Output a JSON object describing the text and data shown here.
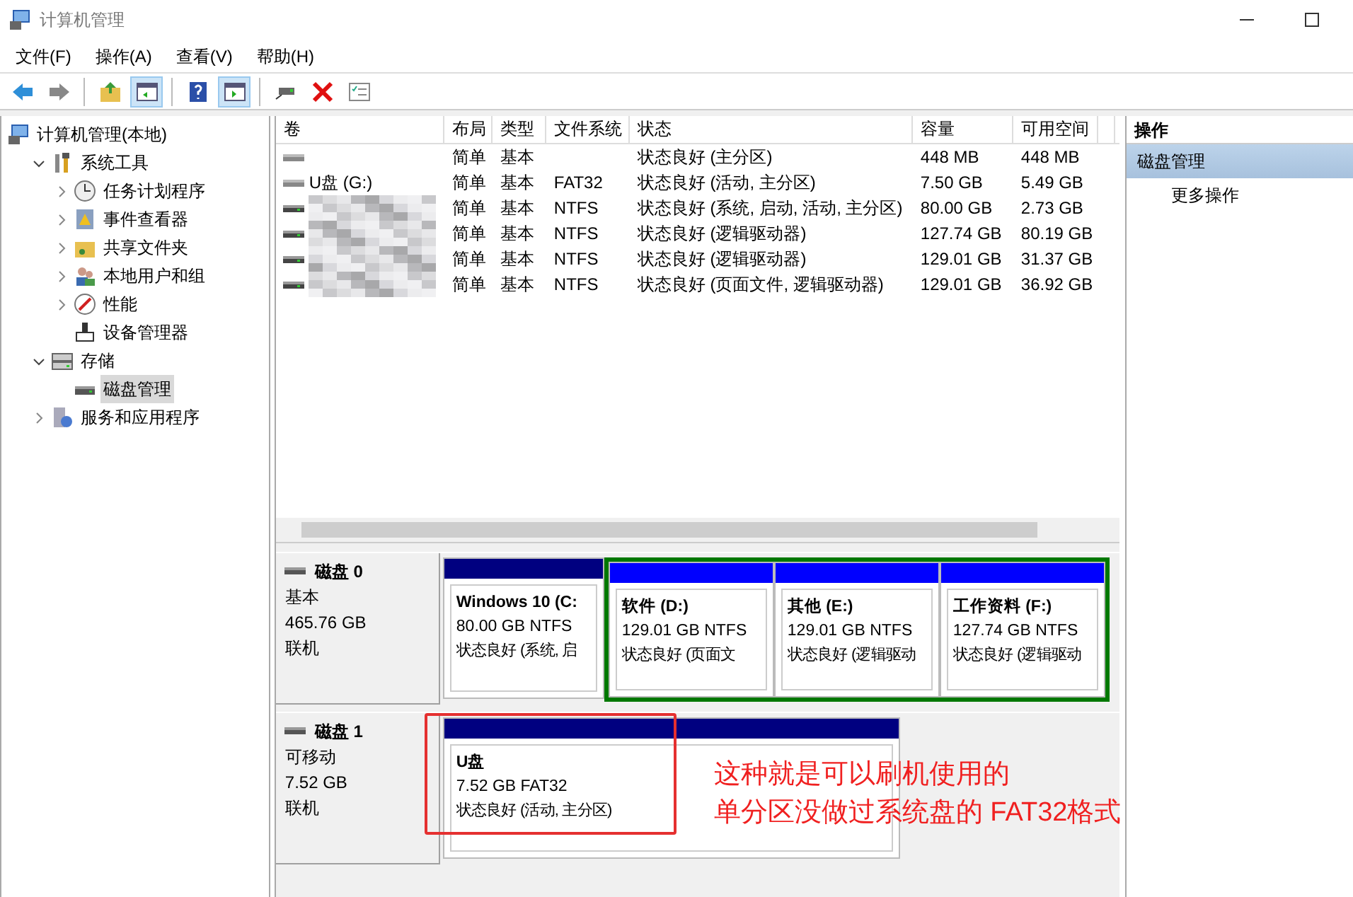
{
  "window": {
    "title": "计算机管理"
  },
  "menu": [
    "文件(F)",
    "操作(A)",
    "查看(V)",
    "帮助(H)"
  ],
  "toolbar": [
    {
      "kind": "back",
      "pressed": false
    },
    {
      "kind": "forward",
      "pressed": false
    },
    {
      "kind": "sep"
    },
    {
      "kind": "up",
      "pressed": false
    },
    {
      "kind": "tree",
      "pressed": true
    },
    {
      "kind": "sep"
    },
    {
      "kind": "help",
      "pressed": false
    },
    {
      "kind": "pane",
      "pressed": true
    },
    {
      "kind": "sep"
    },
    {
      "kind": "connect",
      "pressed": false
    },
    {
      "kind": "delete",
      "pressed": false
    },
    {
      "kind": "props",
      "pressed": false
    }
  ],
  "tree": {
    "label": "计算机管理(本地)",
    "selected": false,
    "children": [
      {
        "label": "系统工具",
        "expanded": true,
        "selected": false,
        "children": [
          {
            "label": "任务计划程序",
            "expanded": false,
            "selected": false
          },
          {
            "label": "事件查看器",
            "expanded": false,
            "selected": false
          },
          {
            "label": "共享文件夹",
            "expanded": false,
            "selected": false
          },
          {
            "label": "本地用户和组",
            "expanded": false,
            "selected": false
          },
          {
            "label": "性能",
            "expanded": false,
            "selected": false
          },
          {
            "label": "设备管理器",
            "selected": false
          }
        ]
      },
      {
        "label": "存储",
        "expanded": true,
        "selected": false,
        "children": [
          {
            "label": "磁盘管理",
            "selected": true
          }
        ]
      },
      {
        "label": "服务和应用程序",
        "expanded": false,
        "selected": false
      }
    ]
  },
  "volumes": {
    "columns": [
      "卷",
      "布局",
      "类型",
      "文件系统",
      "状态",
      "容量",
      "可用空间"
    ],
    "rows": [
      {
        "layout": "简单",
        "type": "基本",
        "status": "状态良好 (主分区)",
        "capacity": "448 MB",
        "free": "448 MB"
      },
      {
        "volume": "U盘 (G:)",
        "layout": "简单",
        "type": "基本",
        "fs": "FAT32",
        "status": "状态良好 (活动, 主分区)",
        "capacity": "7.50 GB",
        "free": "5.49 GB"
      },
      {
        "redacted": true,
        "layout": "简单",
        "type": "基本",
        "fs": "NTFS",
        "status": "状态良好 (系统, 启动, 活动, 主分区)",
        "capacity": "80.00 GB",
        "free": "2.73 GB"
      },
      {
        "redacted": true,
        "layout": "简单",
        "type": "基本",
        "fs": "NTFS",
        "status": "状态良好 (逻辑驱动器)",
        "capacity": "127.74 GB",
        "free": "80.19 GB"
      },
      {
        "redacted": true,
        "layout": "简单",
        "type": "基本",
        "fs": "NTFS",
        "status": "状态良好 (逻辑驱动器)",
        "capacity": "129.01 GB",
        "free": "31.37 GB"
      },
      {
        "redacted": true,
        "layout": "简单",
        "type": "基本",
        "fs": "NTFS",
        "status": "状态良好 (页面文件, 逻辑驱动器)",
        "capacity": "129.01 GB",
        "free": "36.92 GB"
      }
    ]
  },
  "actions": {
    "title": "操作",
    "items": [
      {
        "kind": "section",
        "label": "磁盘管理"
      },
      {
        "kind": "item",
        "label": "更多操作"
      }
    ]
  },
  "disks": [
    {
      "name": "磁盘 0",
      "type": "基本",
      "size": "465.76 GB",
      "state": "联机",
      "partitions": [
        {
          "kind": "primary",
          "name": "Windows 10 (C:",
          "size": "80.00 GB NTFS",
          "status": "状态良好 (系统, 启"
        },
        {
          "kind": "logical",
          "name": "软件 (D:)",
          "size": "129.01 GB NTFS",
          "status": "状态良好 (页面文"
        },
        {
          "kind": "logical",
          "name": "其他 (E:)",
          "size": "129.01 GB NTFS",
          "status": "状态良好 (逻辑驱动"
        },
        {
          "kind": "logical",
          "name": "工作资料 (F:)",
          "size": "127.74 GB NTFS",
          "status": "状态良好 (逻辑驱动"
        }
      ]
    },
    {
      "name": "磁盘 1",
      "type": "可移动",
      "size": "7.52 GB",
      "state": "联机",
      "partitions": [
        {
          "kind": "primary",
          "name": "U盘",
          "size": "7.52 GB FAT32",
          "status": "状态良好 (活动, 主分区)"
        }
      ]
    }
  ],
  "annotation": {
    "lines": [
      "这种就是可以刷机使用的",
      "单分区没做过系统盘的 FAT32格式"
    ]
  }
}
